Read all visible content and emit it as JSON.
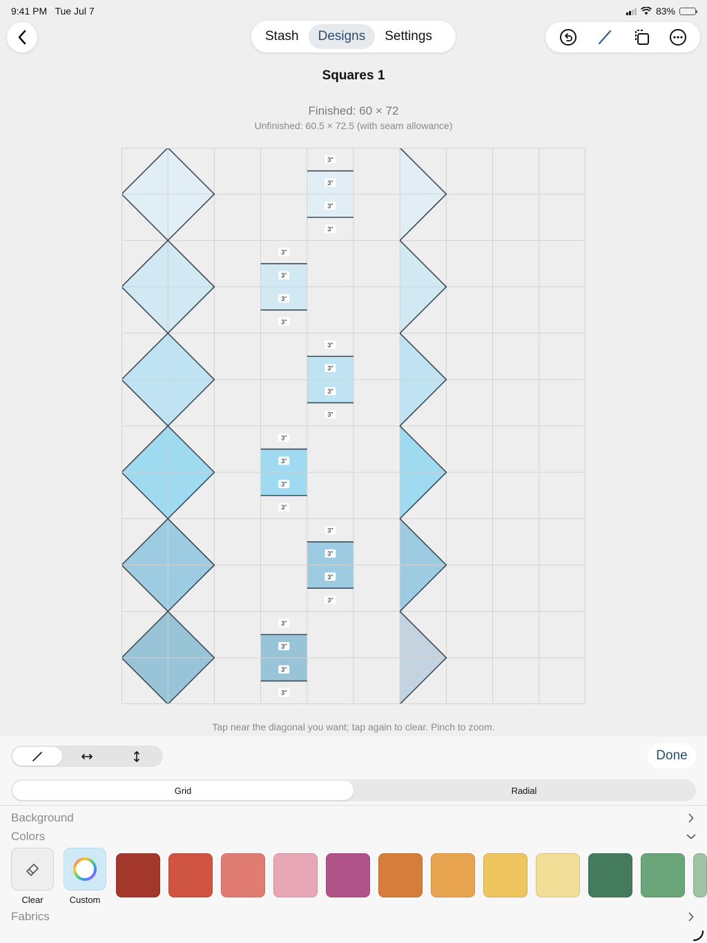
{
  "status": {
    "time": "9:41 PM",
    "date": "Tue Jul 7",
    "battery": "83%"
  },
  "nav": {
    "tabs": [
      {
        "label": "Stash",
        "active": false
      },
      {
        "label": "Designs",
        "active": true
      },
      {
        "label": "Settings",
        "active": false
      }
    ]
  },
  "design": {
    "title": "Squares 1",
    "finished": "Finished: 60 × 72",
    "unfinished": "Unfinished: 60.5 × 72.5 (with seam allowance)"
  },
  "quilt": {
    "columns": 10,
    "rows": 12,
    "block_label": "3\"",
    "row_pair_colors": [
      "#e2eef5",
      "#d2e9f3",
      "#bfe3f2",
      "#9fdaf1",
      "#9ccbe2",
      "#99c3d6"
    ],
    "right_colors": [
      "#e2eef5",
      "#d2e9f3",
      "#bfe3f2",
      "#9fdaf1",
      "#9ccbe2",
      "#c3d3df"
    ],
    "strips": [
      {
        "column": 4,
        "row_pair": 0,
        "color": "#e2eef5"
      },
      {
        "column": 3,
        "row_pair": 1,
        "color": "#d2e9f3"
      },
      {
        "column": 4,
        "row_pair": 2,
        "color": "#bfe3f2"
      },
      {
        "column": 3,
        "row_pair": 3,
        "color": "#9fdaf1"
      },
      {
        "column": 4,
        "row_pair": 4,
        "color": "#9ccbe2"
      },
      {
        "column": 3,
        "row_pair": 5,
        "color": "#99c3d6"
      }
    ]
  },
  "hint": "Tap near the diagonal you want; tap again to clear. Pinch to zoom.",
  "controls": {
    "done": "Done",
    "layouts": [
      {
        "label": "Grid",
        "active": true
      },
      {
        "label": "Radial",
        "active": false
      }
    ],
    "background_label": "Background",
    "colors_label": "Colors",
    "fabrics_label": "Fabrics",
    "clear_label": "Clear",
    "custom_label": "Custom",
    "swatches": [
      "#a4372b",
      "#cf5542",
      "#e07c71",
      "#e8a7b4",
      "#b05389",
      "#d67d3c",
      "#e8a44f",
      "#eec55e",
      "#f2de97",
      "#437b5c",
      "#6ba57a",
      "#9ec2a3"
    ]
  }
}
